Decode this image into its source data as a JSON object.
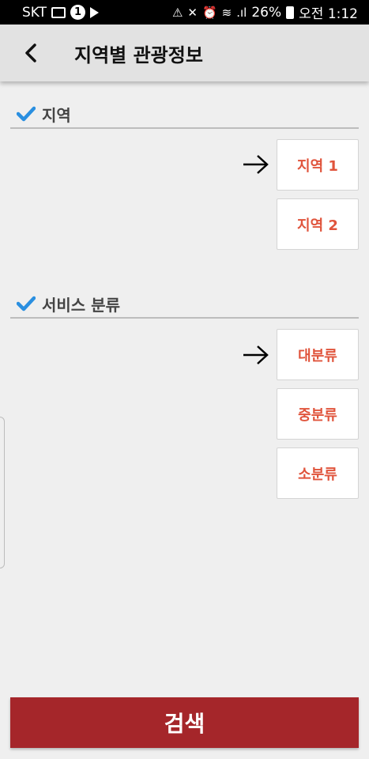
{
  "status_bar": {
    "carrier": "SKT",
    "notification_badge": "1",
    "battery": "26%",
    "time": "오전 1:12",
    "icons": [
      "image-icon",
      "badge-icon",
      "play-icon",
      "network-icon",
      "mute-icon",
      "alarm-icon",
      "wifi-icon",
      "signal-icon",
      "battery-icon"
    ]
  },
  "app_bar": {
    "title": "지역별 관광정보",
    "back_icon": "chevron-left-icon"
  },
  "region_section": {
    "title": "지역",
    "buttons": [
      "지역 1",
      "지역 2"
    ]
  },
  "service_section": {
    "title": "서비스 분류",
    "buttons": [
      "대분류",
      "중분류",
      "소분류"
    ]
  },
  "search_button": {
    "label": "검색"
  },
  "colors": {
    "accent_text": "#e0543c",
    "search_bg": "#a5262a",
    "check": "#2a8fe0",
    "background": "#efefef"
  }
}
